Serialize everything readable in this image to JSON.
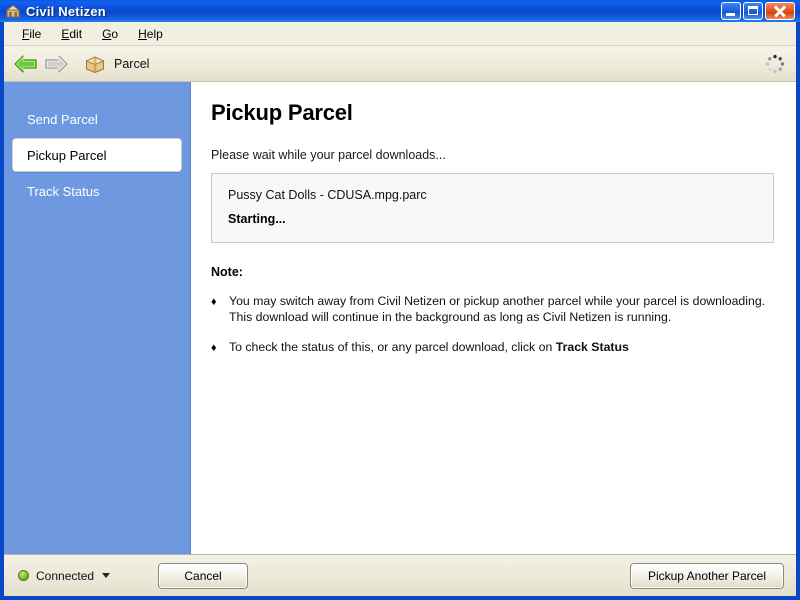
{
  "window": {
    "title": "Civil Netizen",
    "icon": "app-building-icon",
    "controls": {
      "minimize": "Minimize",
      "maximize": "Maximize",
      "close": "Close"
    }
  },
  "menubar": {
    "items": [
      {
        "label": "File",
        "accel": "F"
      },
      {
        "label": "Edit",
        "accel": "E"
      },
      {
        "label": "Go",
        "accel": "G"
      },
      {
        "label": "Help",
        "accel": "H"
      }
    ]
  },
  "toolbar": {
    "back_label": "Back",
    "forward_label": "Forward",
    "location_icon": "parcel-box-icon",
    "location_label": "Parcel",
    "throbber_label": "Loading"
  },
  "sidebar": {
    "items": [
      {
        "label": "Send Parcel",
        "selected": false
      },
      {
        "label": "Pickup Parcel",
        "selected": true
      },
      {
        "label": "Track Status",
        "selected": false
      }
    ]
  },
  "main": {
    "title": "Pickup Parcel",
    "wait_text": "Please wait while your parcel downloads...",
    "download": {
      "file_name": "Pussy Cat Dolls - CDUSA.mpg.parc",
      "status": "Starting..."
    },
    "note_heading": "Note:",
    "notes": [
      {
        "bullet": "♦",
        "text_before": "You may switch away from Civil Netizen or pickup another parcel while your parcel is downloading. This download will continue in the background as long as Civil Netizen is running.",
        "emphasis": "",
        "text_after": ""
      },
      {
        "bullet": "♦",
        "text_before": "To check the status of this, or any parcel download, click on ",
        "emphasis": "Track Status",
        "text_after": ""
      }
    ]
  },
  "statusbar": {
    "connection_status": "Connected",
    "connection_indicator": "green",
    "cancel_label": "Cancel",
    "pickup_another_label": "Pickup Another Parcel"
  },
  "colors": {
    "titlebar_blue": "#0a46c8",
    "sidebar_blue": "#6e99e0",
    "chrome_beige": "#ece9d8",
    "connected_green": "#8cc63f",
    "close_red": "#cf4412"
  }
}
